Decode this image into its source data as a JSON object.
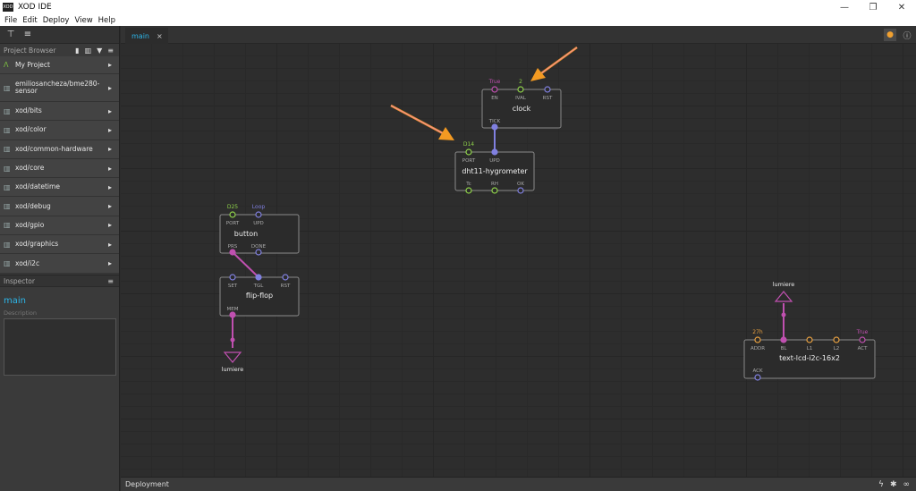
{
  "window": {
    "title": "XOD IDE",
    "logo_text": "XOD",
    "minimize_icon": "minimize-icon",
    "maximize_icon": "restore-icon",
    "close_icon": "close-icon"
  },
  "menu": [
    "File",
    "Edit",
    "Deploy",
    "View",
    "Help"
  ],
  "project_browser": {
    "header": "Project Browser",
    "libraries": [
      {
        "label": "My Project",
        "icon": "project-icon"
      },
      {
        "label": "emiliosancheza/bme280-sensor",
        "icon": "library-icon"
      },
      {
        "label": "xod/bits",
        "icon": "library-icon"
      },
      {
        "label": "xod/color",
        "icon": "library-icon"
      },
      {
        "label": "xod/common-hardware",
        "icon": "library-icon"
      },
      {
        "label": "xod/core",
        "icon": "library-icon"
      },
      {
        "label": "xod/datetime",
        "icon": "library-icon"
      },
      {
        "label": "xod/debug",
        "icon": "library-icon"
      },
      {
        "label": "xod/gpio",
        "icon": "library-icon"
      },
      {
        "label": "xod/graphics",
        "icon": "library-icon"
      },
      {
        "label": "xod/i2c",
        "icon": "library-icon"
      }
    ]
  },
  "inspector": {
    "header": "Inspector",
    "patch_name": "main",
    "description_label": "Description",
    "description_value": ""
  },
  "tabs": [
    {
      "label": "main",
      "close": "×"
    }
  ],
  "bottom_bar": {
    "label": "Deployment"
  },
  "colors": {
    "accent_blue": "#2cb5e8",
    "pulse": "#8080e0",
    "boolean": "#c050b0",
    "number": "#e8a040",
    "port": "#8fd24a",
    "arrow": "#f39a22"
  },
  "nodes": {
    "clock": {
      "title": "clock",
      "pins_top": [
        "EN",
        "IVAL",
        "RST"
      ],
      "values_top": [
        "True",
        "2",
        ""
      ],
      "pins_bottom": [
        "TICK"
      ]
    },
    "dht11": {
      "title": "dht11-hygrometer",
      "pins_top": [
        "PORT",
        "UPD"
      ],
      "values_top": [
        "D14",
        ""
      ],
      "pins_bottom": [
        "Tc",
        "RH",
        "OK"
      ]
    },
    "button": {
      "title": "button",
      "pins_top": [
        "PORT",
        "UPD"
      ],
      "values_top": [
        "D25",
        "Loop"
      ],
      "pins_bottom": [
        "PRS",
        "DONE"
      ]
    },
    "flipflop": {
      "title": "flip-flop",
      "pins_top": [
        "SET",
        "TGL",
        "RST"
      ],
      "pins_bottom": [
        "MEM"
      ]
    },
    "lcd": {
      "title": "text-lcd-i2c-16x2",
      "pins_top": [
        "ADDR",
        "BL",
        "L1",
        "L2",
        "ACT"
      ],
      "values_top": [
        "27h",
        "",
        "",
        "",
        "True"
      ],
      "pins_bottom": [
        "ACK"
      ]
    },
    "bus_out": {
      "label": "lumiere"
    },
    "bus_in": {
      "label": "lumiere"
    }
  }
}
